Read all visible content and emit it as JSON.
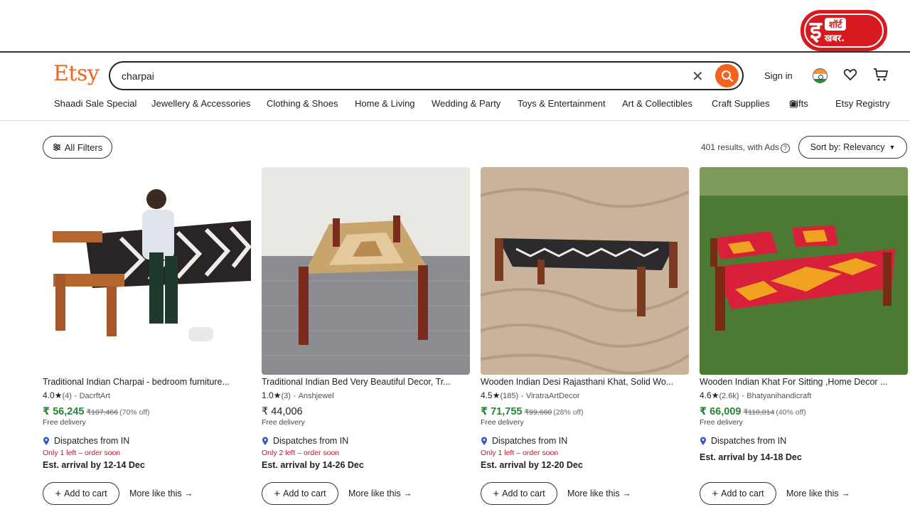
{
  "brand_badge": {
    "big": "इ",
    "line1": "शॉर्ट",
    "line2": "खबर."
  },
  "header": {
    "logo": "Etsy",
    "search_value": "charpai",
    "signin": "Sign in"
  },
  "categories": [
    "Shaadi Sale Special",
    "Jewellery & Accessories",
    "Clothing & Shoes",
    "Home & Living",
    "Wedding & Party",
    "Toys & Entertainment",
    "Art & Collectibles",
    "Craft Supplies",
    "Gifts",
    "Etsy Registry"
  ],
  "toolbar": {
    "filters": "All Filters",
    "results": "401 results, with Ads",
    "sort": "Sort by: Relevancy"
  },
  "listings": [
    {
      "title": "Traditional Indian Charpai - bedroom furniture...",
      "rating": "4.0",
      "reviews": "(4)",
      "shop": "DacrftArt",
      "price": "₹ 56,245",
      "was": "₹107,466",
      "off": "(70% off)",
      "delivery": "Free delivery",
      "dispatch": "Dispatches from IN",
      "stock": "Only 1 left – order soon",
      "arrival": "Est. arrival by 12-14 Dec",
      "add": "Add to cart",
      "more": "More like this"
    },
    {
      "title": "Traditional Indian Bed Very Beautiful Decor, Tr...",
      "rating": "1.0",
      "reviews": "(3)",
      "shop": "Anshjewel",
      "price": "₹ 44,006",
      "was": "",
      "off": "",
      "delivery": "Free delivery",
      "dispatch": "Dispatches from IN",
      "stock": "Only 2 left – order soon",
      "arrival": "Est. arrival by 14-26 Dec",
      "add": "Add to cart",
      "more": "More like this"
    },
    {
      "title": "Wooden Indian Desi Rajasthani Khat, Solid Wo...",
      "rating": "4.5",
      "reviews": "(185)",
      "shop": "ViratraArtDecor",
      "price": "₹ 71,755",
      "was": "₹99,660",
      "off": "(28% off)",
      "delivery": "Free delivery",
      "dispatch": "Dispatches from IN",
      "stock": "Only 1 left – order soon",
      "arrival": "Est. arrival by 12-20 Dec",
      "add": "Add to cart",
      "more": "More like this"
    },
    {
      "title": "Wooden Indian Khat For Sitting ,Home Decor ...",
      "rating": "4.6",
      "reviews": "(2.6k)",
      "shop": "Bhatyanihandicraft",
      "price": "₹ 66,009",
      "was": "₹110,014",
      "off": "(40% off)",
      "delivery": "Free delivery",
      "dispatch": "Dispatches from IN",
      "stock": "",
      "arrival": "Est. arrival by 14-18 Dec",
      "add": "Add to cart",
      "more": "More like this"
    }
  ],
  "colors": {
    "accent": "#f1641e",
    "price": "#258635",
    "stock": "#c8102e"
  }
}
